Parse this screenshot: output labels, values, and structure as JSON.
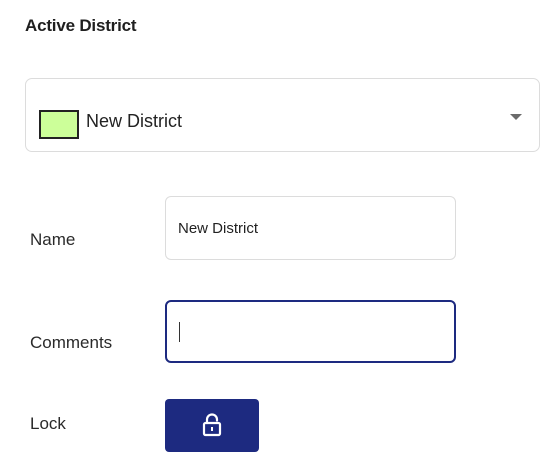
{
  "panel": {
    "title": "Active District"
  },
  "district_select": {
    "selected_label": "New District",
    "swatch_color": "#ccff99",
    "icon": "chevron-down-icon"
  },
  "fields": {
    "name_label": "Name",
    "name_value": "New District",
    "comments_label": "Comments",
    "comments_value": "",
    "lock_label": "Lock"
  },
  "lock_button": {
    "icon": "unlock-icon",
    "state": "unlocked",
    "color": "#1d2a80"
  }
}
